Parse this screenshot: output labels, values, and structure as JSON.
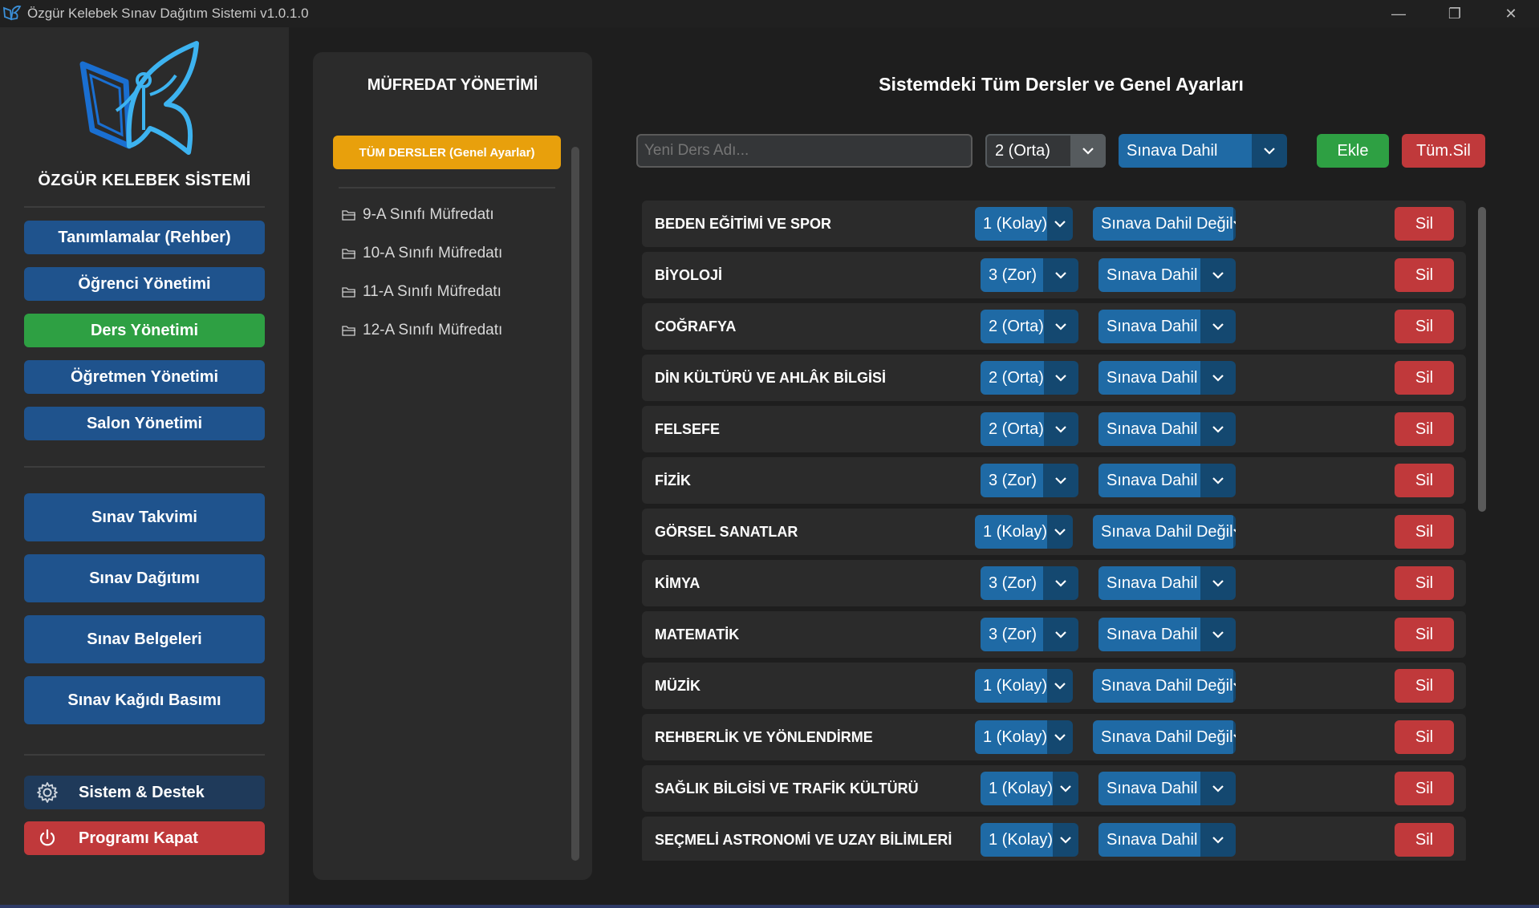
{
  "window": {
    "title": "Özgür Kelebek Sınav Dağıtım Sistemi v1.0.1.0",
    "minimize": "—",
    "maximize": "❐",
    "close": "✕"
  },
  "sidebar": {
    "brand": "ÖZGÜR KELEBEK SİSTEMİ",
    "items": [
      {
        "label": "Tanımlamalar (Rehber)"
      },
      {
        "label": "Öğrenci Yönetimi"
      },
      {
        "label": "Ders Yönetimi"
      },
      {
        "label": "Öğretmen Yönetimi"
      },
      {
        "label": "Salon Yönetimi"
      }
    ],
    "exam_items": [
      {
        "label": "Sınav Takvimi"
      },
      {
        "label": "Sınav Dağıtımı"
      },
      {
        "label": "Sınav Belgeleri"
      },
      {
        "label": "Sınav Kağıdı Basımı"
      }
    ],
    "system_label": "Sistem & Destek",
    "exit_label": "Programı Kapat",
    "active_item": "Ders Yönetimi"
  },
  "curriculum": {
    "title": "MÜFREDAT YÖNETİMİ",
    "all_courses_label": "TÜM DERSLER (Genel Ayarlar)",
    "items": [
      {
        "label": "9-A Sınıfı Müfredatı"
      },
      {
        "label": "10-A Sınıfı Müfredatı"
      },
      {
        "label": "11-A Sınıfı Müfredatı"
      },
      {
        "label": "12-A Sınıfı Müfredatı"
      }
    ]
  },
  "main": {
    "title": "Sistemdeki Tüm Dersler ve Genel Ayarları",
    "new_course_placeholder": "Yeni Ders Adı...",
    "difficulty_default": "2 (Orta)",
    "status_default": "Sınava Dahil",
    "add_label": "Ekle",
    "delete_all_label": "Tüm.Sil",
    "delete_label": "Sil",
    "courses": [
      {
        "name": "BEDEN EĞİTİMİ VE SPOR",
        "difficulty": "1 (Kolay)",
        "status": "Sınava Dahil Değil"
      },
      {
        "name": "BİYOLOJİ",
        "difficulty": "3 (Zor)",
        "status": "Sınava Dahil"
      },
      {
        "name": "COĞRAFYA",
        "difficulty": "2 (Orta)",
        "status": "Sınava Dahil"
      },
      {
        "name": "DİN KÜLTÜRÜ VE AHLÂK BİLGİSİ",
        "difficulty": "2 (Orta)",
        "status": "Sınava Dahil"
      },
      {
        "name": "FELSEFE",
        "difficulty": "2 (Orta)",
        "status": "Sınava Dahil"
      },
      {
        "name": "FİZİK",
        "difficulty": "3 (Zor)",
        "status": "Sınava Dahil"
      },
      {
        "name": "GÖRSEL SANATLAR",
        "difficulty": "1 (Kolay)",
        "status": "Sınava Dahil Değil"
      },
      {
        "name": "KİMYA",
        "difficulty": "3 (Zor)",
        "status": "Sınava Dahil"
      },
      {
        "name": "MATEMATİK",
        "difficulty": "3 (Zor)",
        "status": "Sınava Dahil"
      },
      {
        "name": "MÜZİK",
        "difficulty": "1 (Kolay)",
        "status": "Sınava Dahil Değil"
      },
      {
        "name": "REHBERLİK VE YÖNLENDİRME",
        "difficulty": "1 (Kolay)",
        "status": "Sınava Dahil Değil"
      },
      {
        "name": "SAĞLIK BİLGİSİ VE TRAFİK KÜLTÜRÜ",
        "difficulty": "1 (Kolay)",
        "status": "Sınava Dahil"
      },
      {
        "name": "SEÇMELİ ASTRONOMİ VE UZAY BİLİMLERİ",
        "difficulty": "1 (Kolay)",
        "status": "Sınava Dahil"
      }
    ]
  },
  "colors": {
    "accent_blue": "#1f538d",
    "active_green": "#2ea043",
    "danger_red": "#c0393b",
    "highlight_orange": "#e8a00c"
  },
  "icons": {
    "app": "butterfly-icon",
    "settings": "gear-icon",
    "power": "power-icon",
    "folder": "folder-icon",
    "dropdown": "chevron-down-icon"
  }
}
